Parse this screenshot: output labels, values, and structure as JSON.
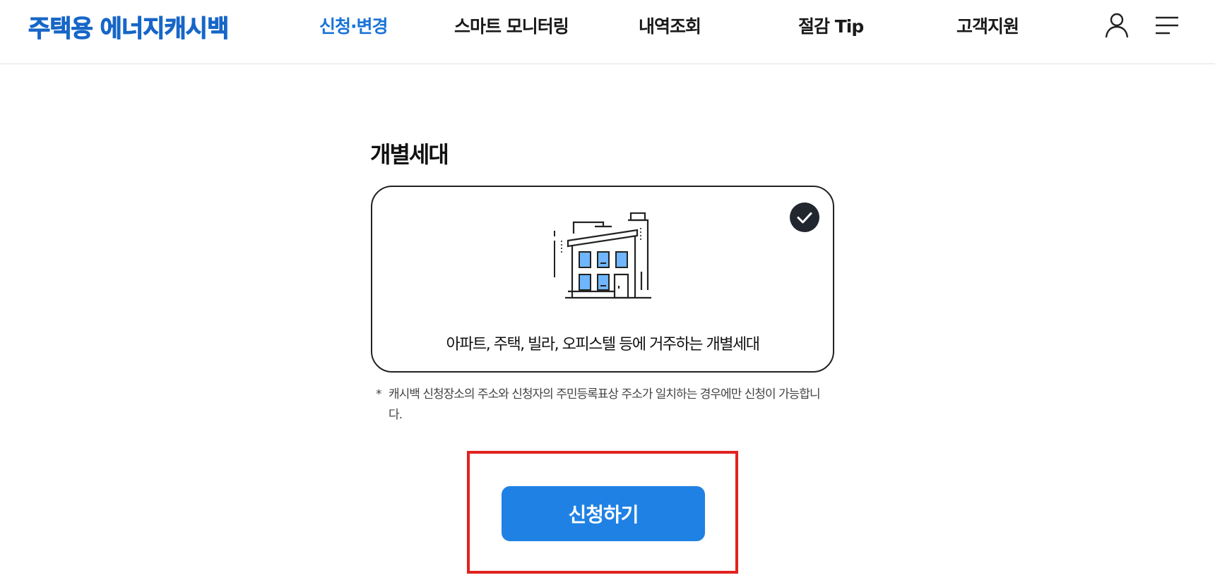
{
  "header": {
    "logo": "주택용 에너지캐시백",
    "nav": [
      {
        "label": "신청·변경",
        "active": true
      },
      {
        "label": "스마트 모니터링",
        "active": false
      },
      {
        "label": "내역조회",
        "active": false
      },
      {
        "label": "절감 Tip",
        "active": false
      },
      {
        "label": "고객지원",
        "active": false
      }
    ],
    "icons": [
      "user-icon",
      "menu-icon"
    ]
  },
  "main": {
    "section_title": "개별세대",
    "card": {
      "icon": "building-icon",
      "selected": true,
      "caption": "아파트, 주택, 빌라, 오피스텔 등에 거주하는 개별세대"
    },
    "note_mark": "*",
    "note": "캐시백 신청장소의 주소와 신청자의 주민등록표상 주소가 일치하는 경우에만 신청이 가능합니다.",
    "apply_button": "신청하기"
  },
  "colors": {
    "brand": "#1766c8",
    "active_nav": "#1a73d9",
    "button": "#1f81e3",
    "window_fill": "#6fb6ff",
    "highlight": "#e1221f"
  }
}
